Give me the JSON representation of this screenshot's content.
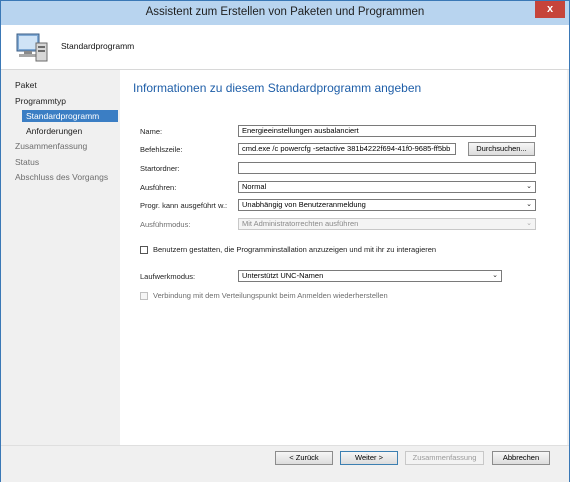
{
  "window": {
    "title": "Assistent zum Erstellen von Paketen und Programmen",
    "close_glyph": "x"
  },
  "header": {
    "title": "Standardprogramm",
    "icon": "computer-package-icon"
  },
  "nav": {
    "items": [
      {
        "label": "Paket"
      },
      {
        "label": "Programmtyp"
      },
      {
        "label": "Standardprogramm"
      },
      {
        "label": "Anforderungen"
      },
      {
        "label": "Zusammenfassung"
      },
      {
        "label": "Status"
      },
      {
        "label": "Abschluss des Vorgangs"
      }
    ]
  },
  "main": {
    "section_title": "Informationen zu diesem Standardprogramm angeben",
    "name_label": "Name:",
    "name_value": "Energieeinstellungen ausbalanciert",
    "cmd_label": "Befehlszeile:",
    "cmd_value": "cmd.exe /c powercfg -setactive 381b4222f694-41f0-9685-ff5bb",
    "browse_label": "Durchsuchen...",
    "startdir_label": "Startordner:",
    "startdir_value": "",
    "run_label": "Ausführen:",
    "run_value": "Normal",
    "canrun_label": "Progr. kann ausgeführt w.:",
    "canrun_value": "Unabhängig von Benutzeranmeldung",
    "runmode_label": "Ausführmodus:",
    "runmode_value": "Mit Administratorrechten ausführen",
    "allow_interact_label": "Benutzern gestatten, die Programminstallation anzuzeigen und mit ihr zu interagieren",
    "drivemode_label": "Laufwerkmodus:",
    "drivemode_value": "Unterstützt UNC-Namen",
    "reconnect_label": "Verbindung mit dem Verteilungspunkt beim Anmelden wiederherstellen",
    "dropdown_glyph": "⌄"
  },
  "footer": {
    "back": "< Zurück",
    "next": "Weiter >",
    "summary": "Zusammenfassung",
    "cancel": "Abbrechen"
  },
  "colors": {
    "accent": "#3b7ec4",
    "title_blue": "#1e5ea8",
    "close_red": "#c6443a"
  }
}
